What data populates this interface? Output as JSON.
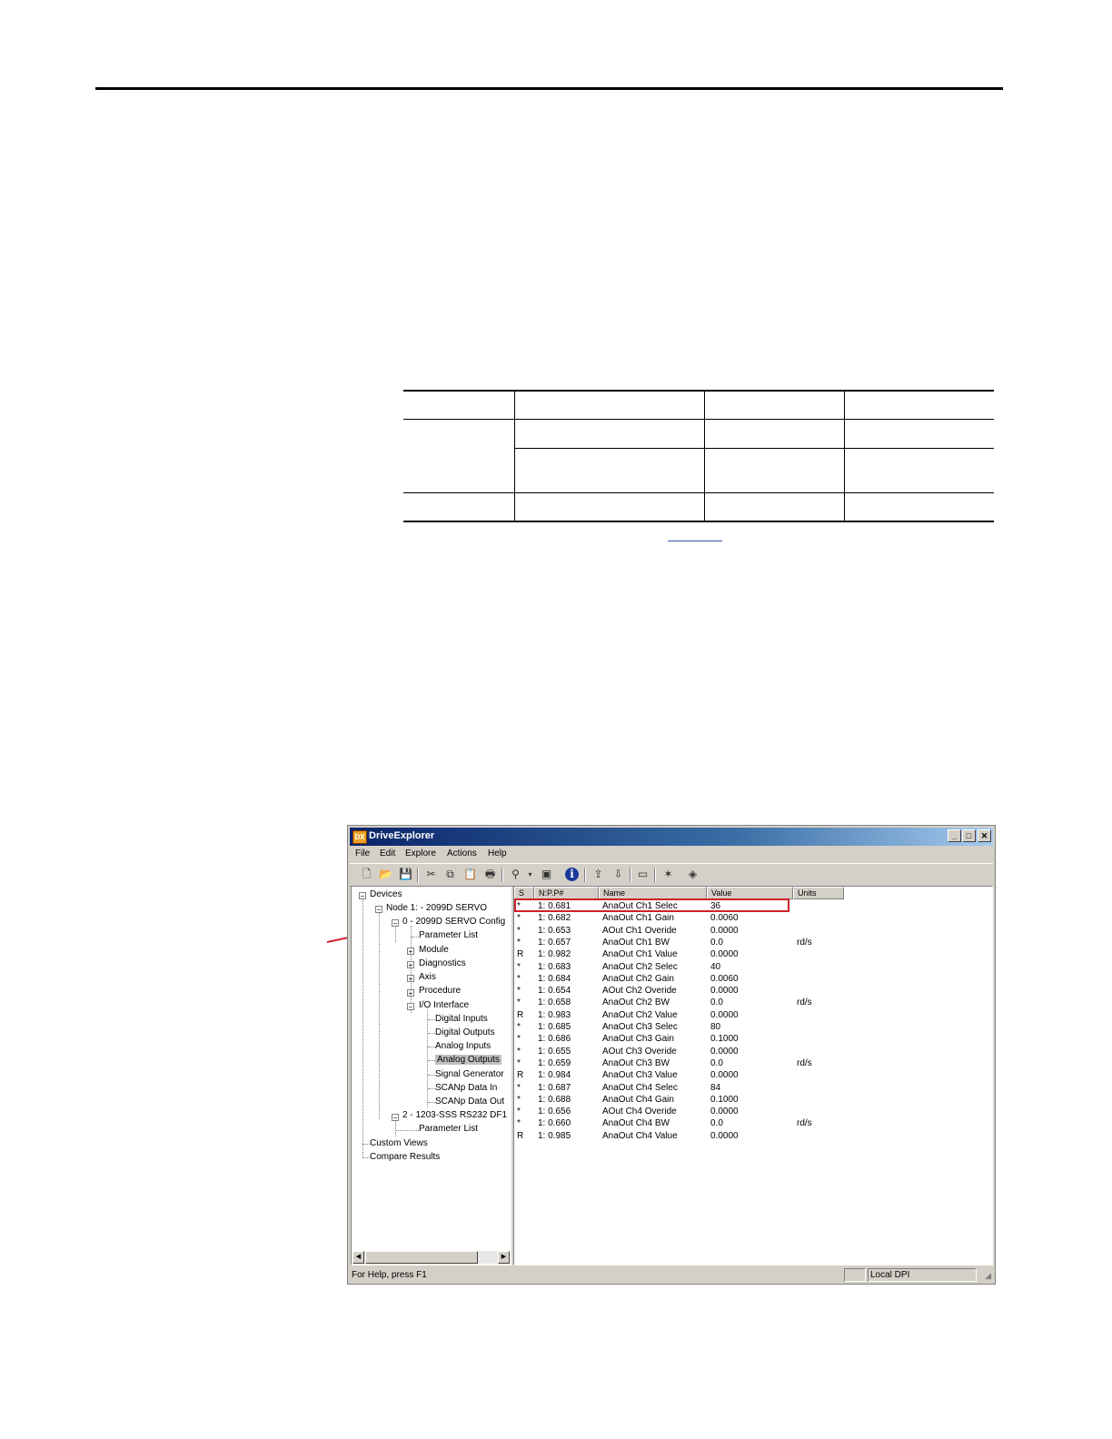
{
  "window": {
    "title": "DriveExplorer",
    "controls": {
      "minimize": "_",
      "maximize": "□",
      "close": "✕"
    }
  },
  "menu": [
    "File",
    "Edit",
    "Explore",
    "Actions",
    "Help"
  ],
  "toolbar_icons": [
    "new-icon",
    "open-icon",
    "save-icon",
    "cut-icon",
    "copy-icon",
    "paste-icon",
    "print-icon",
    "connect-icon",
    "properties-icon",
    "info-icon",
    "upload-icon",
    "download-icon",
    "dpi-icon",
    "wizard-icon",
    "help-book-icon"
  ],
  "tree": {
    "root": "Devices",
    "node1": "Node 1: - 2099D SERVO",
    "node1_config": "0 - 2099D SERVO Config",
    "parameter_list": "Parameter List",
    "module": "Module",
    "diagnostics": "Diagnostics",
    "axis": "Axis",
    "procedure": "Procedure",
    "io_interface": "I/O Interface",
    "digital_inputs": "Digital Inputs",
    "digital_outputs": "Digital Outputs",
    "analog_inputs": "Analog Inputs",
    "analog_outputs": "Analog Outputs",
    "signal_generator": "Signal Generator",
    "scanp_data_in": "SCANp Data In",
    "scanp_data_out": "SCANp Data Out",
    "node2": "2 - 1203-SSS RS232 DF1",
    "node2_parameter_list": "Parameter List",
    "custom_views": "Custom Views",
    "compare_results": "Compare Results"
  },
  "columns": [
    "S",
    "N:P.P#",
    "Name",
    "Value",
    "Units"
  ],
  "rows": [
    {
      "s": "*",
      "npp": "1: 0.681",
      "name": "AnaOut Ch1 Selec",
      "value": "36",
      "units": ""
    },
    {
      "s": "*",
      "npp": "1: 0.682",
      "name": "AnaOut Ch1 Gain",
      "value": "0.0060",
      "units": ""
    },
    {
      "s": "*",
      "npp": "1: 0.653",
      "name": "AOut Ch1 Overide",
      "value": "0.0000",
      "units": ""
    },
    {
      "s": "*",
      "npp": "1: 0.657",
      "name": "AnaOut Ch1 BW",
      "value": "0.0",
      "units": "rd/s"
    },
    {
      "s": "R",
      "npp": "1: 0.982",
      "name": "AnaOut Ch1 Value",
      "value": "0.0000",
      "units": ""
    },
    {
      "s": "*",
      "npp": "1: 0.683",
      "name": "AnaOut Ch2 Selec",
      "value": "40",
      "units": ""
    },
    {
      "s": "*",
      "npp": "1: 0.684",
      "name": "AnaOut Ch2 Gain",
      "value": "0.0060",
      "units": ""
    },
    {
      "s": "*",
      "npp": "1: 0.654",
      "name": "AOut Ch2 Overide",
      "value": "0.0000",
      "units": ""
    },
    {
      "s": "*",
      "npp": "1: 0.658",
      "name": "AnaOut Ch2 BW",
      "value": "0.0",
      "units": "rd/s"
    },
    {
      "s": "R",
      "npp": "1: 0.983",
      "name": "AnaOut Ch2 Value",
      "value": "0.0000",
      "units": ""
    },
    {
      "s": "*",
      "npp": "1: 0.685",
      "name": "AnaOut Ch3 Selec",
      "value": "80",
      "units": ""
    },
    {
      "s": "*",
      "npp": "1: 0.686",
      "name": "AnaOut Ch3 Gain",
      "value": "0.1000",
      "units": ""
    },
    {
      "s": "*",
      "npp": "1: 0.655",
      "name": "AOut Ch3 Overide",
      "value": "0.0000",
      "units": ""
    },
    {
      "s": "*",
      "npp": "1: 0.659",
      "name": "AnaOut Ch3 BW",
      "value": "0.0",
      "units": "rd/s"
    },
    {
      "s": "R",
      "npp": "1: 0.984",
      "name": "AnaOut Ch3 Value",
      "value": "0.0000",
      "units": ""
    },
    {
      "s": "*",
      "npp": "1: 0.687",
      "name": "AnaOut Ch4 Selec",
      "value": "84",
      "units": ""
    },
    {
      "s": "*",
      "npp": "1: 0.688",
      "name": "AnaOut Ch4 Gain",
      "value": "0.1000",
      "units": ""
    },
    {
      "s": "*",
      "npp": "1: 0.656",
      "name": "AOut Ch4 Overide",
      "value": "0.0000",
      "units": ""
    },
    {
      "s": "*",
      "npp": "1: 0.660",
      "name": "AnaOut Ch4 BW",
      "value": "0.0",
      "units": "rd/s"
    },
    {
      "s": "R",
      "npp": "1: 0.985",
      "name": "AnaOut Ch4 Value",
      "value": "0.0000",
      "units": ""
    }
  ],
  "status": {
    "help": "For Help, press F1",
    "connection": "Local DPI"
  },
  "colors": {
    "callout": "#d0202a",
    "titlebar": "#0a246a"
  }
}
